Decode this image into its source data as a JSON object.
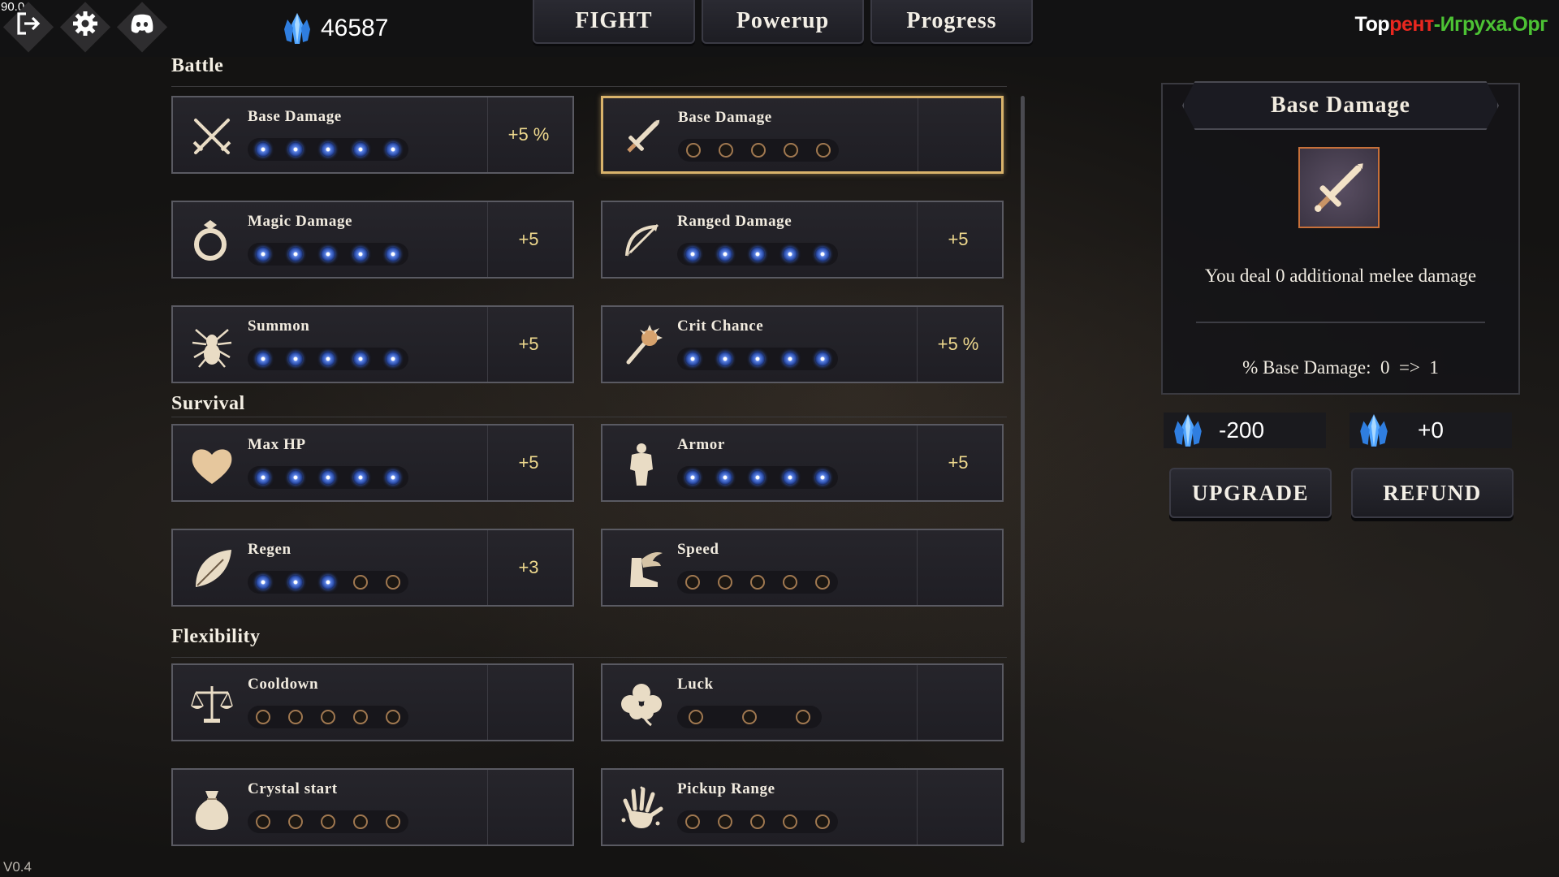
{
  "fps": "90.0",
  "version": "V0.4",
  "topbar": {
    "icons": [
      "exit-icon",
      "gear-icon",
      "discord-icon"
    ],
    "currency": {
      "icon": "crystal-icon",
      "value": "46587"
    },
    "tabs": [
      "FIGHT",
      "Powerup",
      "Progress"
    ],
    "watermark": {
      "part1": "Тор",
      "part2": "рент",
      "part3": "-Игруха",
      "part4": ".Орг"
    }
  },
  "sections": {
    "battle": "Battle",
    "survival": "Survival",
    "flexibility": "Flexibility"
  },
  "upgrades": [
    {
      "name": "Base Damage",
      "icon": "crossed-swords-icon",
      "level": 5,
      "max": 5,
      "bonus": "+5 %"
    },
    {
      "name": "Base Damage",
      "icon": "sword-icon",
      "level": 0,
      "max": 5,
      "bonus": "",
      "selected": true
    },
    {
      "name": "Magic Damage",
      "icon": "ring-icon",
      "level": 5,
      "max": 5,
      "bonus": "+5"
    },
    {
      "name": "Ranged Damage",
      "icon": "bow-icon",
      "level": 5,
      "max": 5,
      "bonus": "+5"
    },
    {
      "name": "Summon",
      "icon": "spider-icon",
      "level": 5,
      "max": 5,
      "bonus": "+5"
    },
    {
      "name": "Crit Chance",
      "icon": "mace-icon",
      "level": 5,
      "max": 5,
      "bonus": "+5 %"
    },
    {
      "name": "Max HP",
      "icon": "heart-icon",
      "level": 5,
      "max": 5,
      "bonus": "+5"
    },
    {
      "name": "Armor",
      "icon": "torso-icon",
      "level": 5,
      "max": 5,
      "bonus": "+5"
    },
    {
      "name": "Regen",
      "icon": "leaf-icon",
      "level": 3,
      "max": 5,
      "bonus": "+3"
    },
    {
      "name": "Speed",
      "icon": "winged-boot-icon",
      "level": 0,
      "max": 5,
      "bonus": ""
    },
    {
      "name": "Cooldown",
      "icon": "scales-icon",
      "level": 0,
      "max": 5,
      "bonus": ""
    },
    {
      "name": "Luck",
      "icon": "clover-icon",
      "level": 0,
      "max": 3,
      "bonus": ""
    },
    {
      "name": "Crystal start",
      "icon": "bag-icon",
      "level": 0,
      "max": 5,
      "bonus": ""
    },
    {
      "name": "Pickup Range",
      "icon": "hand-icon",
      "level": 0,
      "max": 5,
      "bonus": ""
    }
  ],
  "detail": {
    "title": "Base Damage",
    "icon": "sword-icon",
    "description": "You deal 0 additional melee damage",
    "stat": "% Base Damage:  0  =>  1",
    "upgrade_cost": "-200",
    "refund_value": "+0",
    "upgrade_label": "UPGRADE",
    "refund_label": "REFUND"
  },
  "colors": {
    "accent": "#d9b36b",
    "bonus": "#efd98e",
    "pip_on": "#3d6bdc",
    "pip_off": "#a07850"
  }
}
